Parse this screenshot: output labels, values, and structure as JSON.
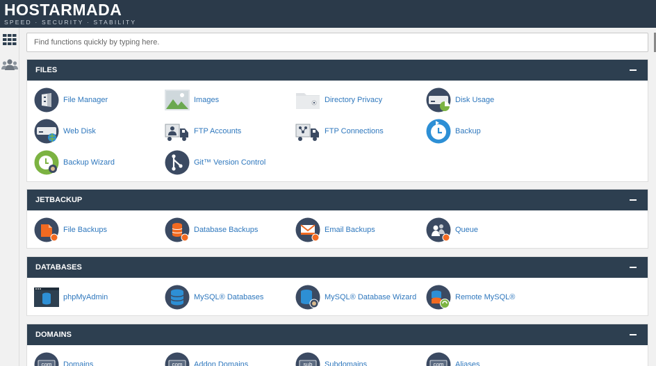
{
  "brand": {
    "name": "HOSTARMADA",
    "tagline": "SPEED · SECURITY · STABILITY"
  },
  "rail": [
    {
      "icon": "grid-icon"
    },
    {
      "icon": "users-icon"
    }
  ],
  "search": {
    "placeholder": "Find functions quickly by typing here."
  },
  "sections": [
    {
      "title": "FILES",
      "items": [
        "File Manager",
        "Images",
        "Directory Privacy",
        "Disk Usage",
        "Web Disk",
        "FTP Accounts",
        "FTP Connections",
        "Backup",
        "Backup Wizard",
        "Git™ Version Control"
      ]
    },
    {
      "title": "JETBACKUP",
      "items": [
        "File Backups",
        "Database Backups",
        "Email Backups",
        "Queue"
      ]
    },
    {
      "title": "DATABASES",
      "items": [
        "phpMyAdmin",
        "MySQL® Databases",
        "MySQL® Database Wizard",
        "Remote MySQL®"
      ]
    },
    {
      "title": "DOMAINS",
      "items": [
        "Domains",
        "Addon Domains",
        "Subdomains",
        "Aliases"
      ]
    }
  ],
  "icon_text": {
    "com": "com",
    "sub": "sub"
  },
  "colors": {
    "topbar": "#2b3a4a",
    "panel_header": "#2d3f50",
    "link": "#2e77bd",
    "icon_navy": "#3b4a62",
    "icon_blue": "#2d8fd5",
    "icon_orange": "#f26a21",
    "icon_green": "#7cb342"
  }
}
